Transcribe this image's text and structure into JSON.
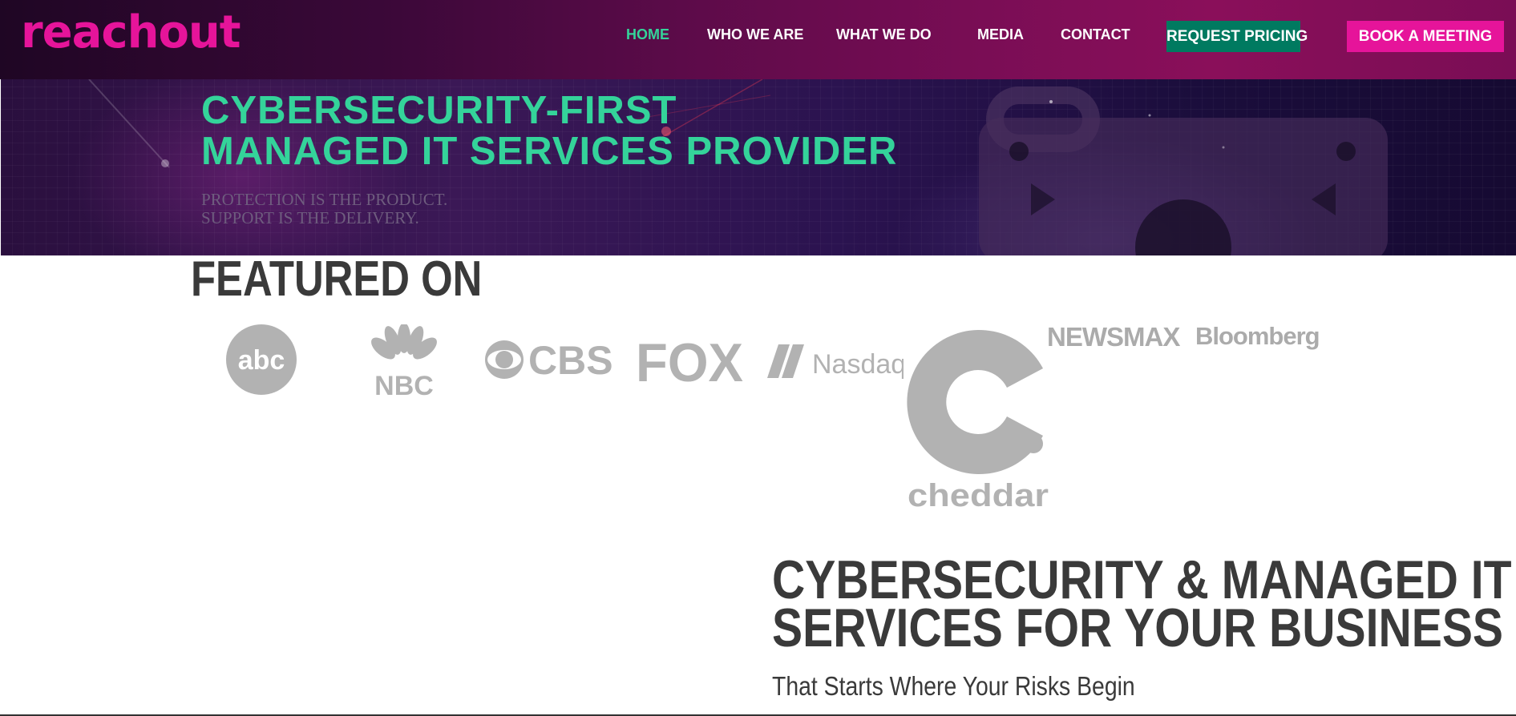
{
  "header": {
    "logo_text": "reachout",
    "nav": [
      {
        "label": "HOME",
        "active": true
      },
      {
        "label": "WHO WE ARE",
        "active": false
      },
      {
        "label": "WHAT WE DO",
        "active": false
      },
      {
        "label": "MEDIA",
        "active": false
      },
      {
        "label": "CONTACT",
        "active": false
      }
    ],
    "request_pricing_label": "REQUEST PRICING",
    "book_meeting_label": "BOOK A MEETING"
  },
  "hero": {
    "title_line1": "CYBERSECURITY-FIRST",
    "title_line2": "MANAGED IT SERVICES PROVIDER",
    "subtitle_line1": "PROTECTION IS THE PRODUCT.",
    "subtitle_line2": "SUPPORT IS THE DELIVERY."
  },
  "featured": {
    "title": "FEATURED ON",
    "logos": [
      {
        "name": "abc",
        "icon": "abc-logo-icon"
      },
      {
        "name": "NBC",
        "icon": "nbc-logo-icon"
      },
      {
        "name": "CBS",
        "icon": "cbs-logo-icon"
      },
      {
        "name": "FOX",
        "icon": "fox-logo-icon"
      },
      {
        "name": "Nasdaq",
        "icon": "nasdaq-logo-icon"
      },
      {
        "name": "cheddar",
        "icon": "cheddar-logo-icon"
      },
      {
        "name": "NEWSMAX",
        "icon": "newsmax-logo-icon"
      },
      {
        "name": "Bloomberg",
        "icon": "bloomberg-logo-icon"
      }
    ]
  },
  "services": {
    "heading_line1": "CYBERSECURITY & MANAGED IT",
    "heading_line2": "SERVICES FOR YOUR BUSINESS",
    "tagline": "That Starts Where Your Risks Begin"
  },
  "colors": {
    "brand_pink": "#e6149a",
    "accent_green": "#34d39a",
    "button_green": "#007a60",
    "logo_gray": "#ababab",
    "heading_dark": "#3a3a3a"
  }
}
